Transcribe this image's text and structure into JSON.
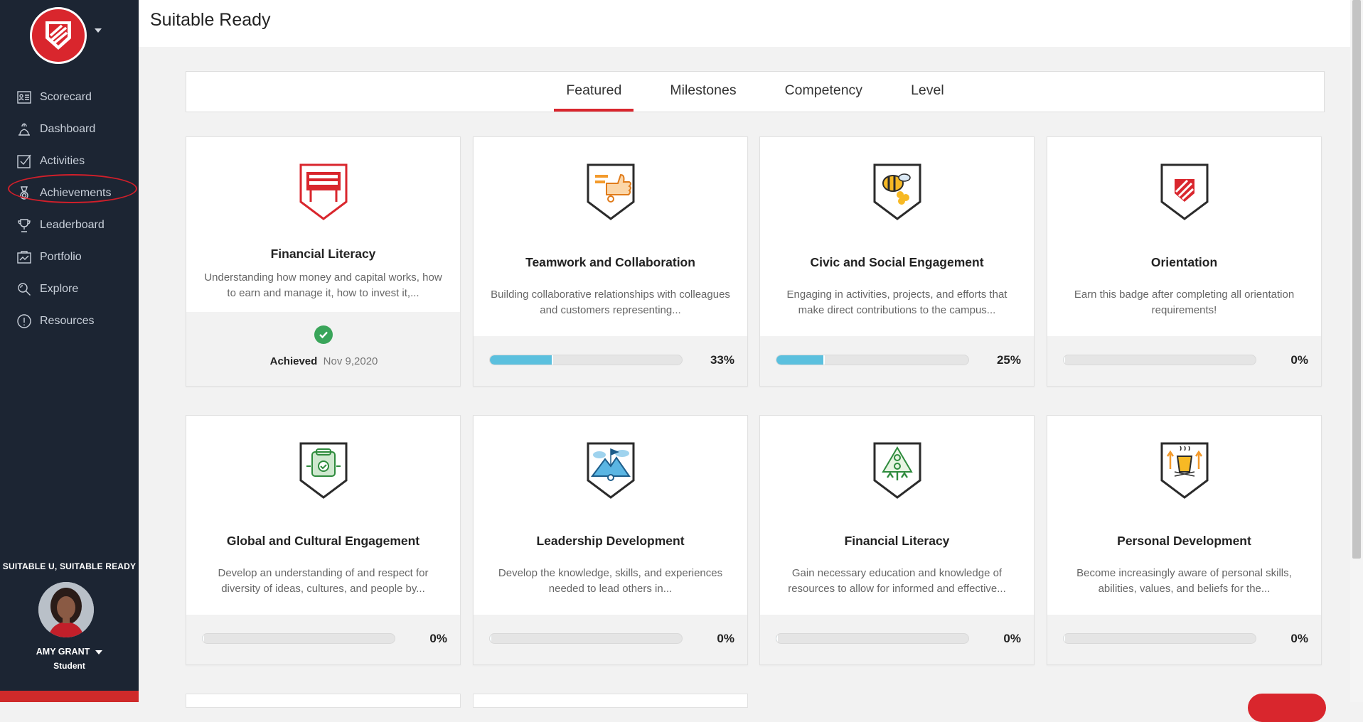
{
  "header": {
    "title": "Suitable Ready"
  },
  "sidebar": {
    "items": [
      {
        "label": "Scorecard",
        "icon": "scorecard-icon"
      },
      {
        "label": "Dashboard",
        "icon": "dashboard-icon"
      },
      {
        "label": "Activities",
        "icon": "activities-icon"
      },
      {
        "label": "Achievements",
        "icon": "achievements-icon"
      },
      {
        "label": "Leaderboard",
        "icon": "leaderboard-icon"
      },
      {
        "label": "Portfolio",
        "icon": "portfolio-icon"
      },
      {
        "label": "Explore",
        "icon": "explore-icon"
      },
      {
        "label": "Resources",
        "icon": "resources-icon"
      }
    ],
    "org_name": "SUITABLE U, SUITABLE READY",
    "user": {
      "name": "AMY GRANT",
      "role": "Student"
    }
  },
  "tabs": [
    {
      "label": "Featured",
      "active": true
    },
    {
      "label": "Milestones",
      "active": false
    },
    {
      "label": "Competency",
      "active": false
    },
    {
      "label": "Level",
      "active": false
    }
  ],
  "cards": [
    {
      "title": "Financial Literacy",
      "desc": "Understanding how money and capital works, how to earn and manage it, how to invest it,...",
      "status": "achieved",
      "achieved_label": "Achieved",
      "achieved_date": "Nov 9,2020",
      "badge": "financial-literacy-banner-badge"
    },
    {
      "title": "Teamwork and Collaboration",
      "desc": "Building collaborative relationships with colleagues and customers representing...",
      "progress": 33,
      "progress_label": "33%",
      "badge": "thumbs-up-badge"
    },
    {
      "title": "Civic and Social Engagement",
      "desc": "Engaging in activities, projects, and efforts that make direct contributions to the campus...",
      "progress": 25,
      "progress_label": "25%",
      "badge": "bee-badge"
    },
    {
      "title": "Orientation",
      "desc": "Earn this badge after completing all orientation requirements!",
      "progress": 0,
      "progress_label": "0%",
      "badge": "shield-badge"
    },
    {
      "title": "Global and Cultural Engagement",
      "desc": "Develop an understanding of and respect for diversity of ideas, cultures, and people by...",
      "progress": 0,
      "progress_label": "0%",
      "badge": "backpack-badge"
    },
    {
      "title": "Leadership Development",
      "desc": "Develop the knowledge, skills, and experiences needed to lead others in...",
      "progress": 0,
      "progress_label": "0%",
      "badge": "mountain-flag-badge"
    },
    {
      "title": "Financial Literacy",
      "desc": "Gain necessary education and knowledge of resources to allow for informed and effective...",
      "progress": 0,
      "progress_label": "0%",
      "badge": "money-tree-badge"
    },
    {
      "title": "Personal Development",
      "desc": "Become increasingly aware of personal skills, abilities, values, and beliefs for the...",
      "progress": 0,
      "progress_label": "0%",
      "badge": "coffee-arrows-badge"
    }
  ],
  "colors": {
    "accent": "#d9262d",
    "sidebar_bg": "#1c2533",
    "progress": "#5bc0de",
    "success": "#3aa55a"
  }
}
